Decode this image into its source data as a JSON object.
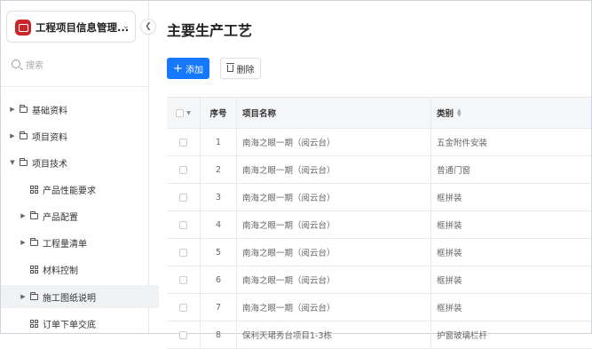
{
  "app": {
    "title": "工程项目信息管理..."
  },
  "sidebar": {
    "search_placeholder": "搜索",
    "items": [
      {
        "label": "基础资料",
        "type": "folder",
        "expanded": false
      },
      {
        "label": "项目资料",
        "type": "folder",
        "expanded": false
      },
      {
        "label": "项目技术",
        "type": "folder",
        "expanded": true
      },
      {
        "label": "产品性能要求",
        "type": "page"
      },
      {
        "label": "产品配置",
        "type": "folder",
        "expanded": false
      },
      {
        "label": "工程量清单",
        "type": "folder",
        "expanded": false
      },
      {
        "label": "材料控制",
        "type": "page"
      },
      {
        "label": "施工图纸说明",
        "type": "folder",
        "expanded": false,
        "active": true
      },
      {
        "label": "订单下单交底",
        "type": "page"
      }
    ]
  },
  "main": {
    "title": "主要生产工艺",
    "add_label": "添加",
    "delete_label": "删除",
    "table": {
      "headers": {
        "no": "序号",
        "name": "项目名称",
        "category": "类别"
      },
      "rows": [
        {
          "no": "1",
          "name": "南海之眼一期（阅云台）",
          "category": "五金附件安装"
        },
        {
          "no": "2",
          "name": "南海之眼一期（阅云台）",
          "category": "普通门窗"
        },
        {
          "no": "3",
          "name": "南海之眼一期（阅云台）",
          "category": "框拼装"
        },
        {
          "no": "4",
          "name": "南海之眼一期（阅云台）",
          "category": "框拼装"
        },
        {
          "no": "5",
          "name": "南海之眼一期（阅云台）",
          "category": "框拼装"
        },
        {
          "no": "6",
          "name": "南海之眼一期（阅云台）",
          "category": "框拼装"
        },
        {
          "no": "7",
          "name": "南海之眼一期（阅云台）",
          "category": "框拼装"
        },
        {
          "no": "8",
          "name": "保利天珺秀台项目1-3栋",
          "category": "护窗玻璃栏杆"
        }
      ]
    }
  },
  "colors": {
    "primary": "#1677ff",
    "logo": "#c8262a"
  }
}
